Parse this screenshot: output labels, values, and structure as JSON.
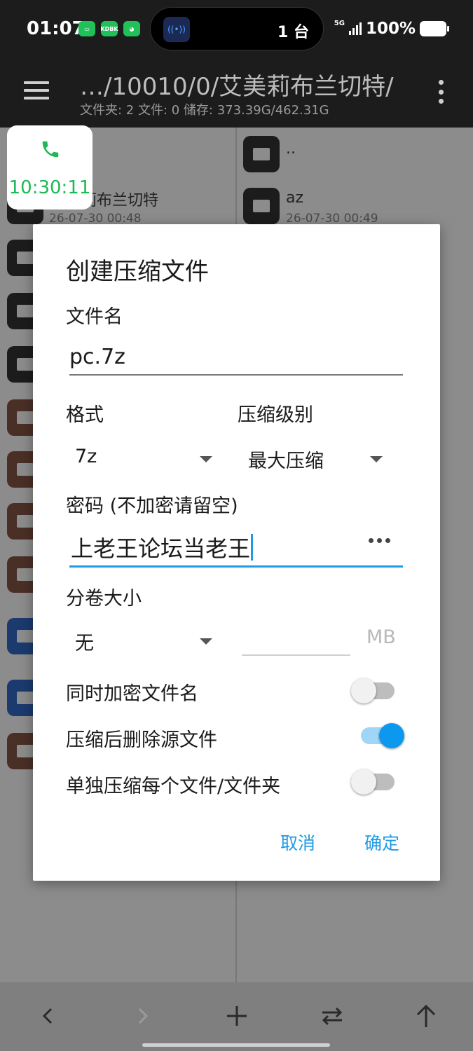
{
  "status_bar": {
    "time": "01:07",
    "apps": [
      "chat-app-icon",
      "KDBK",
      "wechat-icon"
    ],
    "island_text": "1 台",
    "network": "5G",
    "battery": "100%"
  },
  "app_bar": {
    "path": "…/10010/0/艾美莉布兰切特/",
    "stats": "文件夹: 2  文件: 0  储存: 373.39G/462.31G"
  },
  "left_pane": {
    "rows": [
      {
        "name": "莉布兰切特",
        "date": "26-07-30 00:48",
        "icon": "folder-icon"
      }
    ],
    "icon_types": [
      "folder-icon",
      "folder-icon",
      "folder-icon",
      "archive-icon",
      "archive-icon",
      "archive-icon",
      "archive-icon",
      "document-icon",
      "document-icon",
      "archive-icon"
    ]
  },
  "right_pane": {
    "rows": [
      {
        "name": "..",
        "date": "",
        "icon": "folder-icon"
      },
      {
        "name": "az",
        "date": "26-07-30 00:49",
        "icon": "folder-icon"
      }
    ]
  },
  "call_bubble": {
    "time": "10:30:11"
  },
  "dialog": {
    "title": "创建压缩文件",
    "filename_label": "文件名",
    "filename_value": "pc.7z",
    "format_label": "格式",
    "format_value": "7z",
    "level_label": "压缩级别",
    "level_value": "最大压缩",
    "password_label": "密码 (不加密请留空)",
    "password_value": "上老王论坛当老王",
    "volume_label": "分卷大小",
    "volume_value": "无",
    "volume_unit": "MB",
    "toggles": [
      {
        "label": "同时加密文件名",
        "on": false
      },
      {
        "label": "压缩后删除源文件",
        "on": true
      },
      {
        "label": "单独压缩每个文件/文件夹",
        "on": false
      }
    ],
    "cancel_label": "取消",
    "ok_label": "确定"
  },
  "colors": {
    "accent": "#1e9be6",
    "call_green": "#1db954",
    "dark_bar": "#1c1c1c"
  }
}
